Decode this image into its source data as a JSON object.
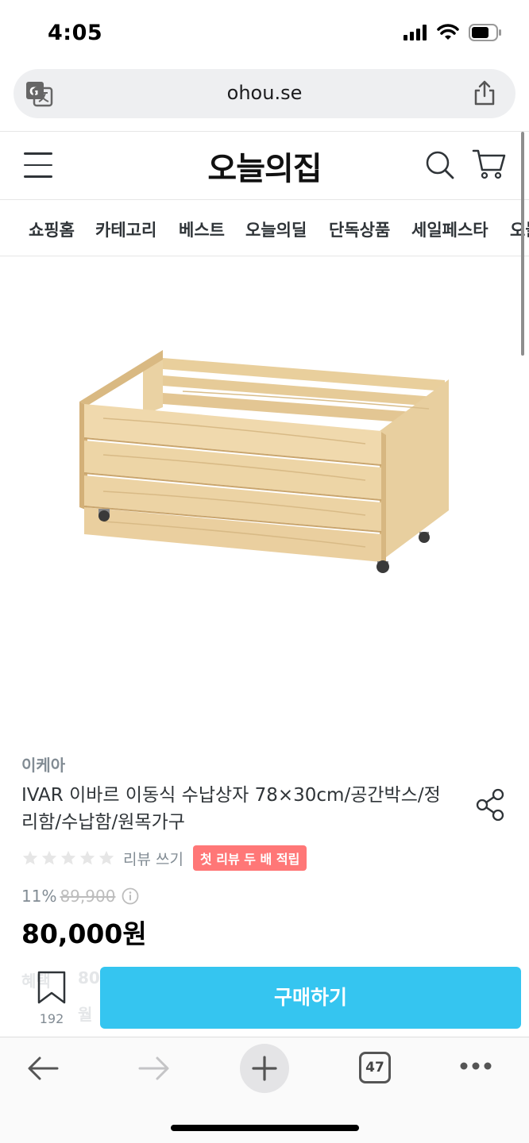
{
  "status": {
    "time": "4:05"
  },
  "browser": {
    "url": "ohou.se"
  },
  "header": {
    "logo": "오늘의집"
  },
  "nav": {
    "tabs": [
      "쇼핑홈",
      "카테고리",
      "베스트",
      "오늘의딜",
      "단독상품",
      "세일페스타",
      "오늘"
    ]
  },
  "product": {
    "brand": "이케아",
    "title": "IVAR 이바르 이동식 수납상자 78×30cm/공간박스/정리함/수납함/원목가구",
    "rating": 0,
    "review_link": "리뷰 쓰기",
    "review_badge": "첫 리뷰 두 배 적립",
    "discount": "11%",
    "original_price": "89,900",
    "sale_price": "80,000원",
    "ghost_labels": [
      "혜택",
      "80",
      "월"
    ]
  },
  "actions": {
    "bookmark_count": "192",
    "buy_label": "구매하기"
  },
  "toolbar": {
    "tab_count": "47"
  },
  "colors": {
    "accent": "#35c5f0",
    "badge": "#ff7777"
  }
}
